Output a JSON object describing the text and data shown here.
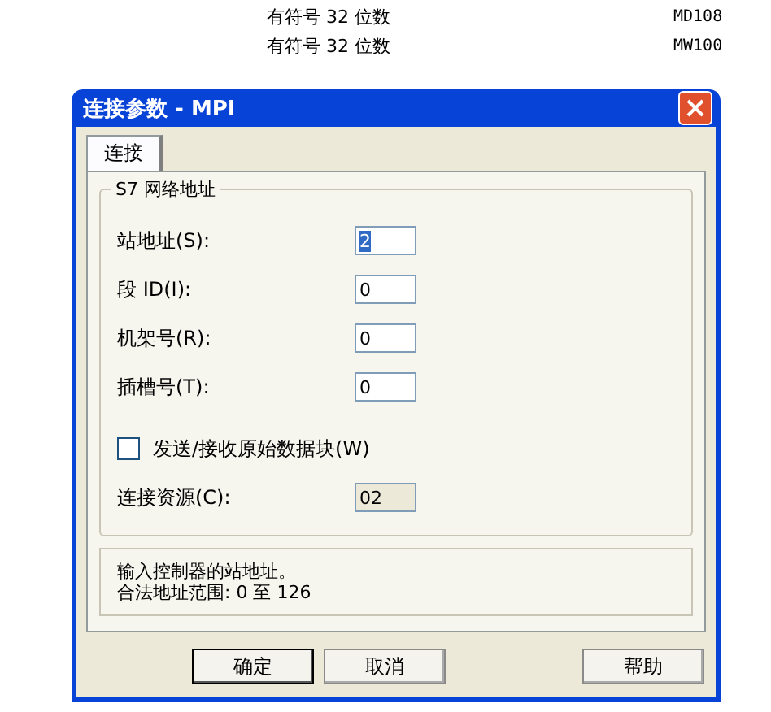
{
  "background_rows": [
    {
      "type": "有符号 32 位数",
      "address": "MD108"
    },
    {
      "type": "有符号 32 位数",
      "address": "MW100"
    }
  ],
  "window": {
    "title": "连接参数 - MPI"
  },
  "tabs": [
    {
      "label": "连接",
      "selected": true
    }
  ],
  "group": {
    "title": "S7 网络地址",
    "fields": [
      {
        "label": "站地址(S):",
        "value": "2",
        "selected": true
      },
      {
        "label": "段 ID(I):",
        "value": "0",
        "selected": false
      },
      {
        "label": "机架号(R):",
        "value": "0",
        "selected": false
      },
      {
        "label": "插槽号(T):",
        "value": "0",
        "selected": false
      }
    ],
    "checkbox": {
      "label": "发送/接收原始数据块(W)",
      "checked": false
    },
    "readonly_field": {
      "label": "连接资源(C):",
      "value": "02"
    }
  },
  "help_text": [
    "输入控制器的站地址。",
    "合法地址范围: 0 至 126"
  ],
  "buttons": [
    {
      "label": "确定",
      "default": true
    },
    {
      "label": "取消",
      "default": false
    },
    {
      "label": "帮助",
      "default": false
    }
  ]
}
